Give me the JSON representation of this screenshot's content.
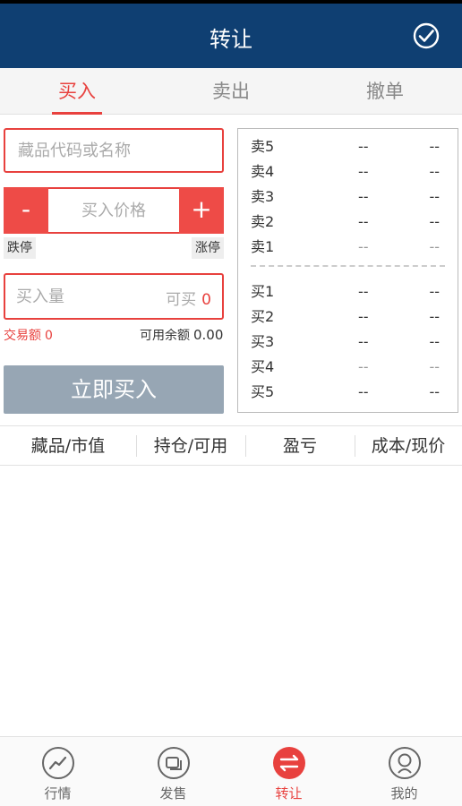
{
  "header": {
    "title": "转让"
  },
  "tabs": [
    {
      "label": "买入",
      "active": true
    },
    {
      "label": "卖出",
      "active": false
    },
    {
      "label": "撤单",
      "active": false
    }
  ],
  "form": {
    "code_placeholder": "藏品代码或名称",
    "minus_label": "-",
    "plus_label": "+",
    "price_placeholder": "买入价格",
    "limit_down": "跌停",
    "limit_up": "涨停",
    "qty_placeholder": "买入量",
    "avail_label": "可买",
    "avail_value": "0",
    "amount_label": "交易额",
    "amount_value": "0",
    "balance_label": "可用余额",
    "balance_value": "0.00",
    "buy_button": "立即买入"
  },
  "order_book": {
    "sell": [
      {
        "label": "卖5",
        "price": "--",
        "volume": "--"
      },
      {
        "label": "卖4",
        "price": "--",
        "volume": "--"
      },
      {
        "label": "卖3",
        "price": "--",
        "volume": "--"
      },
      {
        "label": "卖2",
        "price": "--",
        "volume": "--"
      },
      {
        "label": "卖1",
        "price": "--",
        "volume": "--"
      }
    ],
    "buy": [
      {
        "label": "买1",
        "price": "--",
        "volume": "--"
      },
      {
        "label": "买2",
        "price": "--",
        "volume": "--"
      },
      {
        "label": "买3",
        "price": "--",
        "volume": "--"
      },
      {
        "label": "买4",
        "price": "--",
        "volume": "--"
      },
      {
        "label": "买5",
        "price": "--",
        "volume": "--"
      }
    ]
  },
  "columns": [
    "藏品/市值",
    "持仓/可用",
    "盈亏",
    "成本/现价"
  ],
  "tabbar": [
    {
      "label": "行情",
      "icon": "chart-line-icon",
      "active": false
    },
    {
      "label": "发售",
      "icon": "stack-icon",
      "active": false
    },
    {
      "label": "转让",
      "icon": "transfer-icon",
      "active": true
    },
    {
      "label": "我的",
      "icon": "user-icon",
      "active": false
    }
  ],
  "colors": {
    "header": "#0f3f72",
    "accent": "#e8413e",
    "button_disabled": "#97a6b4"
  }
}
